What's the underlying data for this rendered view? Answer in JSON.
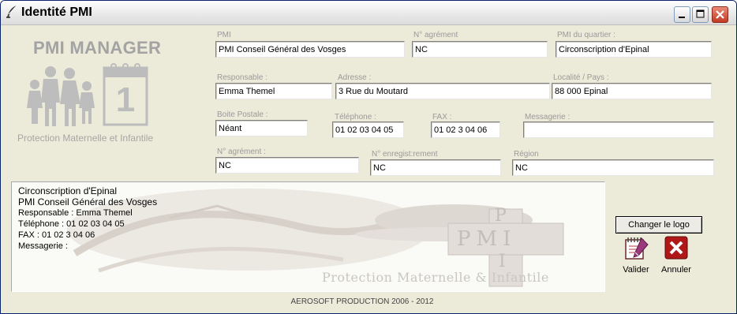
{
  "window": {
    "title": "Identité PMI",
    "icon": "quill-icon",
    "controls": [
      "minimize",
      "maximize",
      "close"
    ]
  },
  "brand": {
    "title": "PMI MANAGER",
    "calendar_number": "1",
    "subtitle": "Protection Maternelle et Infantile"
  },
  "fields": {
    "pmi": {
      "label": "PMI",
      "value": "PMI Conseil Général des Vosges"
    },
    "agrement1": {
      "label": "N° agrément",
      "value": "NC"
    },
    "pmi_quartier": {
      "label": "PMI du quartier :",
      "value": "Circonscription d'Epinal"
    },
    "responsable": {
      "label": "Responsable :",
      "value": "Emma Themel"
    },
    "adresse": {
      "label": "Adresse :",
      "value": "3 Rue du Moutard"
    },
    "localite": {
      "label": "Localité / Pays :",
      "value": "88 000 Epinal"
    },
    "boite_postale": {
      "label": "Boite Postale :",
      "value": "Néant"
    },
    "telephone": {
      "label": "Téléphone :",
      "value": "01 02 03 04 05"
    },
    "fax": {
      "label": "FAX :",
      "value": "01 02 3 04 06"
    },
    "messagerie": {
      "label": "Messagerie :",
      "value": ""
    },
    "agrement2": {
      "label": "N° agrément :",
      "value": "NC"
    },
    "enregistrement": {
      "label": "N° enregist:rement",
      "value": "NC"
    },
    "region": {
      "label": "Région",
      "value": "NC"
    }
  },
  "preview": {
    "lines": [
      "Circonscription d'Epinal",
      "PMI Conseil Général des Vosges",
      "Responsable : Emma Themel",
      "Téléphone :  01 02 03 04 05",
      "FAX : 01 02 3 04 06",
      "Messagerie :"
    ],
    "watermark_letters": [
      "P",
      "PMI",
      "I"
    ],
    "watermark_text": "Protection Maternelle & Infantile"
  },
  "actions": {
    "change_logo": "Changer le logo",
    "validate": "Valider",
    "cancel": "Annuler"
  },
  "footer": "AEROSOFT PRODUCTION  2006 - 2012",
  "colors": {
    "window_bg": "#ecead8",
    "brand_gray": "#a3a3a3",
    "cancel_red": "#b01818"
  }
}
